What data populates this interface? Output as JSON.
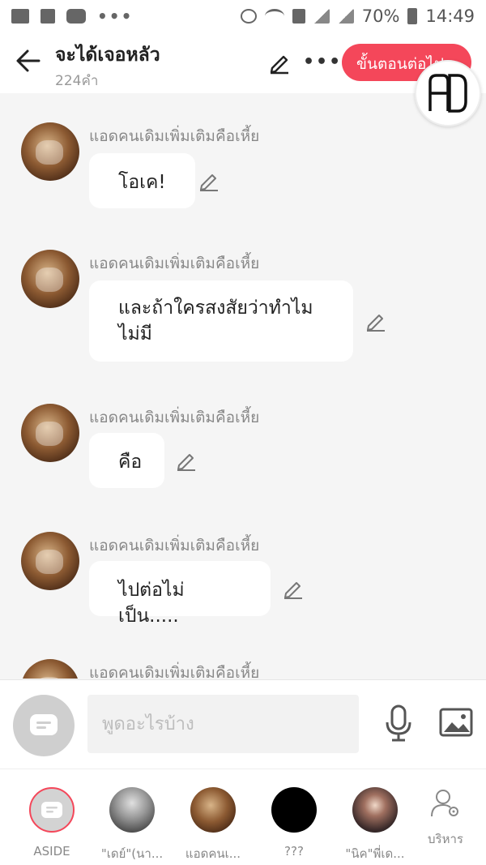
{
  "status_bar": {
    "battery": "70%",
    "time": "14:49",
    "more": "•••"
  },
  "header": {
    "title": "จะได้เจอหลัว",
    "subtitle": "224คำ",
    "next_button": "ขั้นตอนต่อไป",
    "more": "•••",
    "logo": "AD"
  },
  "messages": [
    {
      "sender": "แอดคนเดิมเพิ่มเติมคือเหี้ย",
      "text": "โอเค!"
    },
    {
      "sender": "แอดคนเดิมเพิ่มเติมคือเหี้ย",
      "text": "และถ้าใครสงสัยว่าทำไม\nไม่มี"
    },
    {
      "sender": "แอดคนเดิมเพิ่มเติมคือเหี้ย",
      "text": "คือ"
    },
    {
      "sender": "แอดคนเดิมเพิ่มเติมคือเหี้ย",
      "text": "ไปต่อไม่เป็น....."
    },
    {
      "sender": "แอดคนเดิมเพิ่มเติมคือเหี้ย",
      "text": ""
    }
  ],
  "input": {
    "placeholder": "พูดอะไรบ้าง"
  },
  "bottom_nav": [
    {
      "label": "ASIDE"
    },
    {
      "label": "\"เดย์\"(นา..."
    },
    {
      "label": "แอดคนเ..."
    },
    {
      "label": "???"
    },
    {
      "label": "\"นิค\"พี่เด..."
    },
    {
      "label": "บริหาร"
    }
  ],
  "colors": {
    "accent": "#f4475a",
    "background": "#f5f5f5"
  }
}
